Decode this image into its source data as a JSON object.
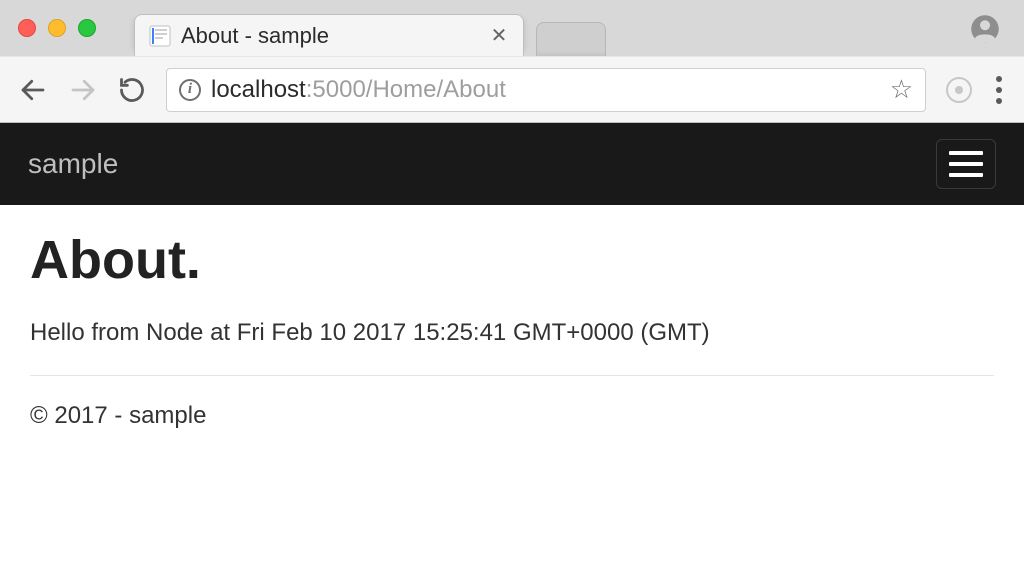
{
  "browser": {
    "tab_title": "About - sample",
    "url": {
      "host": "localhost",
      "rest": ":5000/Home/About"
    }
  },
  "navbar": {
    "brand": "sample"
  },
  "content": {
    "heading": "About.",
    "message": "Hello from Node at Fri Feb 10 2017 15:25:41 GMT+0000 (GMT)"
  },
  "footer": {
    "text": "© 2017 - sample"
  }
}
